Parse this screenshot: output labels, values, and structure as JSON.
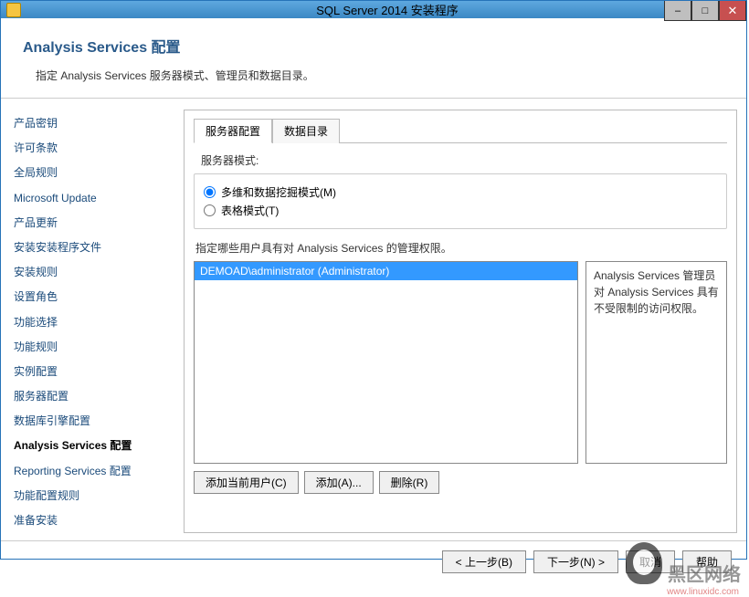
{
  "window": {
    "title": "SQL Server 2014 安装程序"
  },
  "header": {
    "title": "Analysis Services 配置",
    "subtitle": "指定 Analysis Services 服务器模式、管理员和数据目录。"
  },
  "sidebar": {
    "items": [
      {
        "label": "产品密钥",
        "active": false
      },
      {
        "label": "许可条款",
        "active": false
      },
      {
        "label": "全局规则",
        "active": false
      },
      {
        "label": "Microsoft Update",
        "active": false
      },
      {
        "label": "产品更新",
        "active": false
      },
      {
        "label": "安装安装程序文件",
        "active": false
      },
      {
        "label": "安装规则",
        "active": false
      },
      {
        "label": "设置角色",
        "active": false
      },
      {
        "label": "功能选择",
        "active": false
      },
      {
        "label": "功能规则",
        "active": false
      },
      {
        "label": "实例配置",
        "active": false
      },
      {
        "label": "服务器配置",
        "active": false
      },
      {
        "label": "数据库引擎配置",
        "active": false
      },
      {
        "label": "Analysis Services 配置",
        "active": true
      },
      {
        "label": "Reporting Services 配置",
        "active": false
      },
      {
        "label": "功能配置规则",
        "active": false
      },
      {
        "label": "准备安装",
        "active": false
      }
    ]
  },
  "main": {
    "tabs": [
      {
        "label": "服务器配置",
        "active": true
      },
      {
        "label": "数据目录",
        "active": false
      }
    ],
    "server_mode": {
      "label": "服务器模式:",
      "options": [
        {
          "label": "多维和数据挖掘模式(M)",
          "selected": true
        },
        {
          "label": "表格模式(T)",
          "selected": false
        }
      ]
    },
    "permissions_label": "指定哪些用户具有对 Analysis Services 的管理权限。",
    "listbox_items": [
      "DEMOAD\\administrator (Administrator)"
    ],
    "desc": "Analysis Services 管理员对 Analysis Services 具有不受限制的访问权限。",
    "buttons": {
      "add_current": "添加当前用户(C)",
      "add": "添加(A)...",
      "remove": "删除(R)"
    }
  },
  "footer": {
    "back": "< 上一步(B)",
    "next": "下一步(N) >",
    "cancel": "取消",
    "help": "帮助"
  },
  "watermark": {
    "text": "黑区网络",
    "url": "www.linuxidc.com"
  }
}
